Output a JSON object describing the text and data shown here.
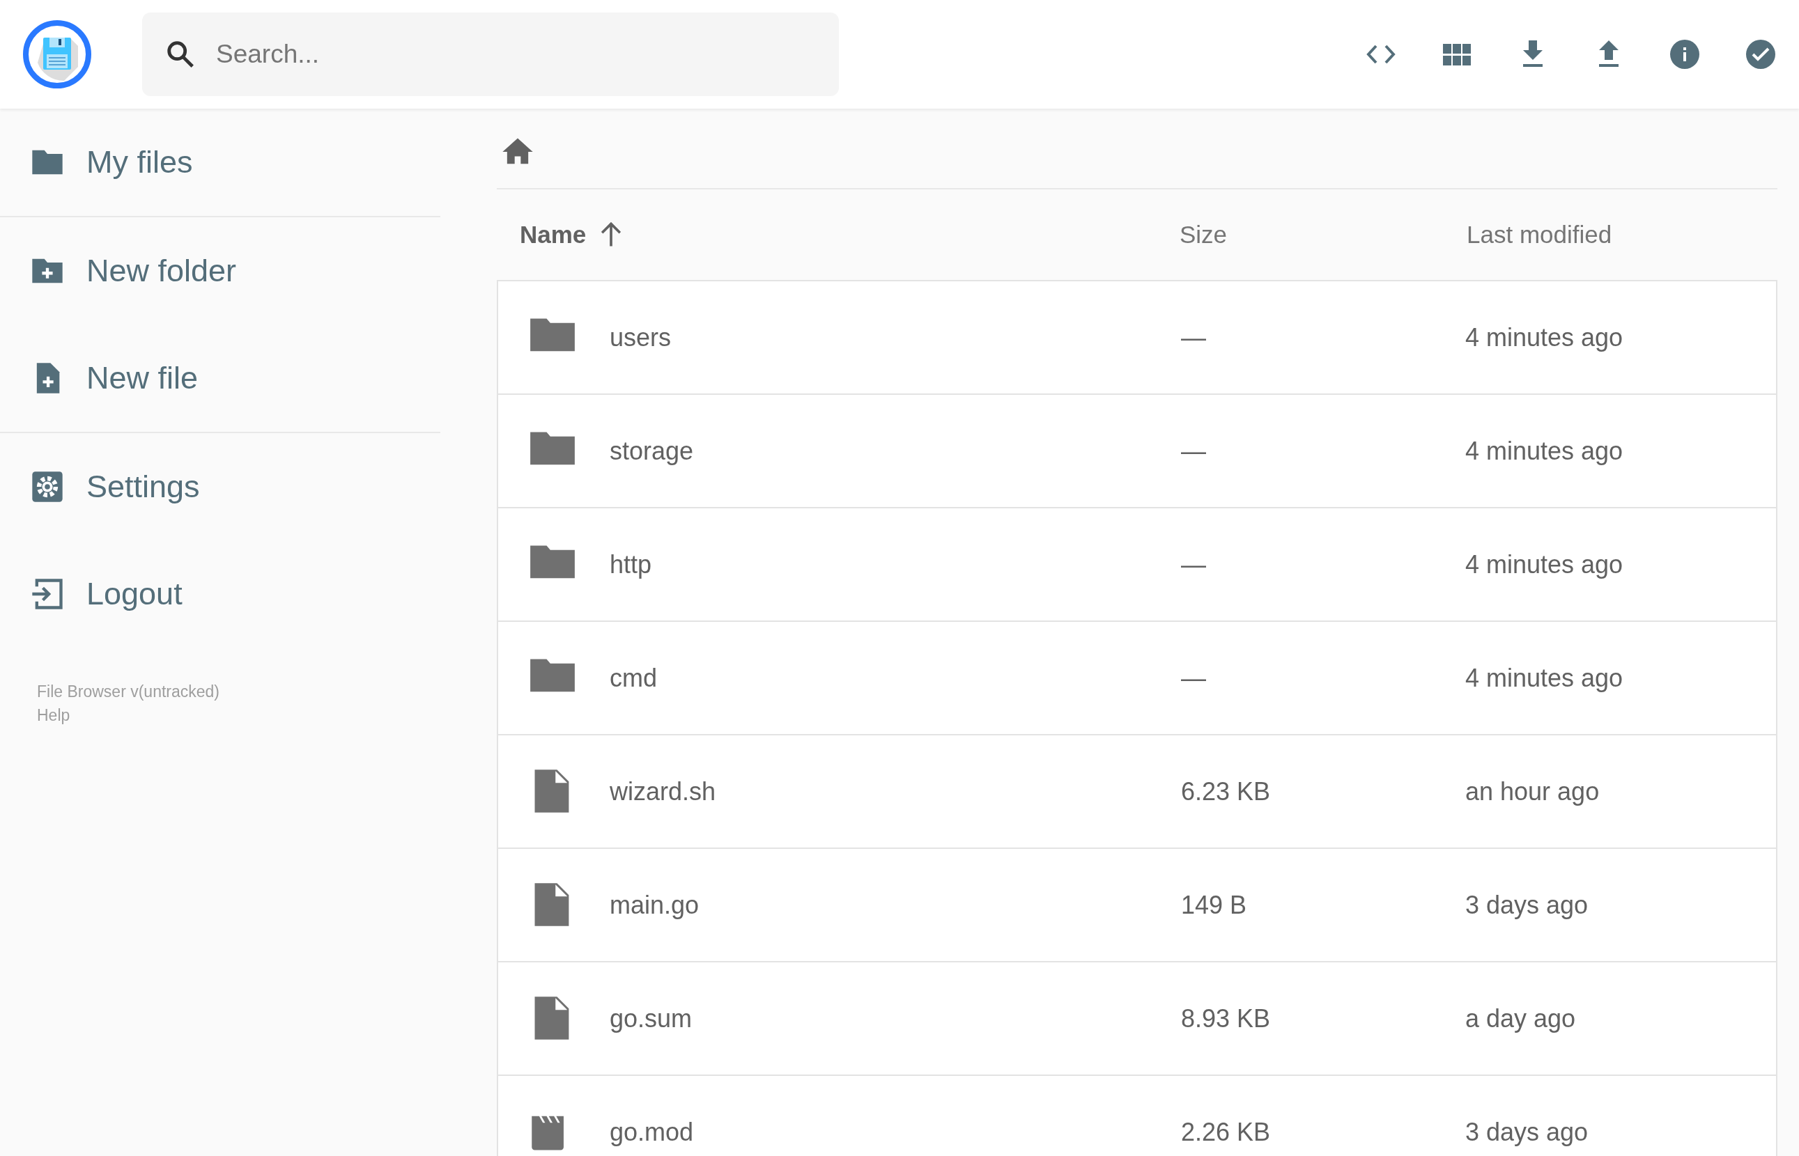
{
  "header": {
    "search": {
      "placeholder": "Search..."
    },
    "actions": [
      {
        "kind": "code"
      },
      {
        "kind": "grid"
      },
      {
        "kind": "download"
      },
      {
        "kind": "upload"
      },
      {
        "kind": "info"
      },
      {
        "kind": "check"
      }
    ]
  },
  "sidebar": {
    "groups": [
      [
        {
          "kind": "folder",
          "label": "My files"
        }
      ],
      [
        {
          "kind": "new-folder",
          "label": "New folder"
        },
        {
          "kind": "new-file",
          "label": "New file"
        }
      ],
      [
        {
          "kind": "settings",
          "label": "Settings"
        },
        {
          "kind": "logout",
          "label": "Logout"
        }
      ]
    ],
    "footer": [
      "File Browser v(untracked)",
      "Help"
    ]
  },
  "listing": {
    "columns": [
      {
        "label": "Name",
        "sorted": true
      },
      {
        "label": "Size",
        "sorted": false
      },
      {
        "label": "Last modified",
        "sorted": false
      }
    ],
    "rows": [
      {
        "kind": "folder",
        "name": "users",
        "size": "—",
        "modified": "4 minutes ago"
      },
      {
        "kind": "folder",
        "name": "storage",
        "size": "—",
        "modified": "4 minutes ago"
      },
      {
        "kind": "folder",
        "name": "http",
        "size": "—",
        "modified": "4 minutes ago"
      },
      {
        "kind": "folder",
        "name": "cmd",
        "size": "—",
        "modified": "4 minutes ago"
      },
      {
        "kind": "file",
        "name": "wizard.sh",
        "size": "6.23 KB",
        "modified": "an hour ago"
      },
      {
        "kind": "file",
        "name": "main.go",
        "size": "149 B",
        "modified": "3 days ago"
      },
      {
        "kind": "file",
        "name": "go.sum",
        "size": "8.93 KB",
        "modified": "a day ago"
      },
      {
        "kind": "video",
        "name": "go.mod",
        "size": "2.26 KB",
        "modified": "3 days ago"
      }
    ]
  }
}
